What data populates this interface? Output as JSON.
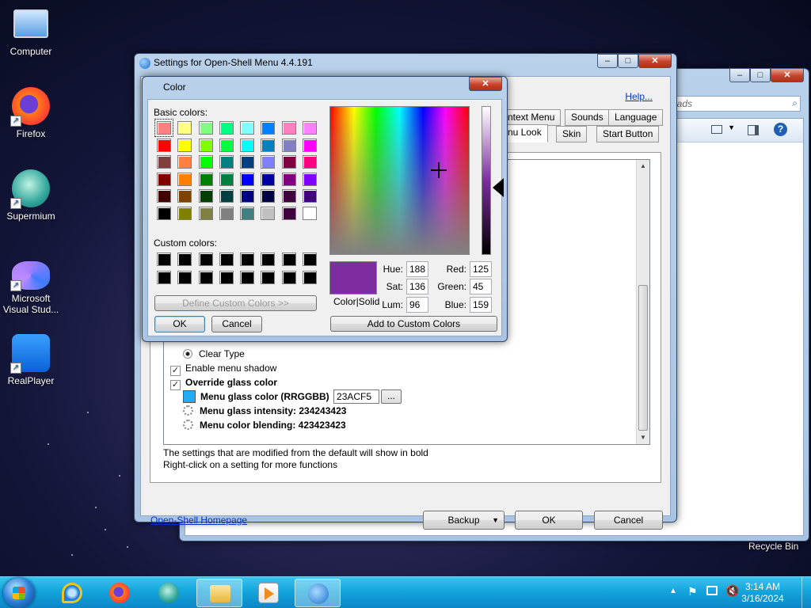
{
  "desktop": {
    "icons": [
      {
        "label": "Computer"
      },
      {
        "label": "Firefox"
      },
      {
        "label": "Supermium"
      },
      {
        "label": "Microsoft\nVisual Stud..."
      },
      {
        "label": "RealPlayer"
      }
    ],
    "recycle_bin": "Recycle Bin"
  },
  "explorer": {
    "search_placeholder": "oads"
  },
  "settings": {
    "title": "Settings for Open-Shell Menu 4.4.191",
    "help": "Help...",
    "tabs": [
      "ntext Menu",
      "Sounds",
      "Language",
      "nu Look",
      "Skin",
      "Start Button"
    ],
    "options": {
      "clear_type": "Clear Type",
      "enable_shadow": "Enable menu shadow",
      "override_glass": "Override glass color",
      "glass_color_label": "Menu glass color (RRGGBB)",
      "glass_color_value": "23ACF5",
      "glass_color_btn": "...",
      "glass_intensity": "Menu glass intensity: 234243423",
      "color_blending": "Menu color blending: 423423423"
    },
    "notes": [
      "The settings that are modified from the default will show in bold",
      "Right-click on a setting for more functions"
    ],
    "homepage": "Open-Shell Homepage",
    "buttons": {
      "backup": "Backup",
      "ok": "OK",
      "cancel": "Cancel"
    }
  },
  "color_dialog": {
    "title": "Color",
    "basic_colors_label": "Basic colors:",
    "custom_colors_label": "Custom colors:",
    "basic_colors": [
      "#ff8080",
      "#ffff80",
      "#80ff80",
      "#00ff80",
      "#80ffff",
      "#0080ff",
      "#ff80c0",
      "#ff80ff",
      "#ff0000",
      "#ffff00",
      "#80ff00",
      "#00ff40",
      "#00ffff",
      "#0080c0",
      "#8080c0",
      "#ff00ff",
      "#804040",
      "#ff8040",
      "#00ff00",
      "#008080",
      "#004080",
      "#8080ff",
      "#800040",
      "#ff0080",
      "#800000",
      "#ff8000",
      "#008000",
      "#008040",
      "#0000ff",
      "#0000a0",
      "#800080",
      "#8000ff",
      "#400000",
      "#804000",
      "#004000",
      "#004040",
      "#000080",
      "#000040",
      "#400040",
      "#400080",
      "#000000",
      "#808000",
      "#808040",
      "#808080",
      "#408080",
      "#c0c0c0",
      "#400040",
      "#ffffff"
    ],
    "custom_colors": [
      "#000000",
      "#000000",
      "#000000",
      "#000000",
      "#000000",
      "#000000",
      "#000000",
      "#000000",
      "#000000",
      "#000000",
      "#000000",
      "#000000",
      "#000000",
      "#000000",
      "#000000",
      "#000000"
    ],
    "define_custom": "Define Custom Colors >>",
    "ok": "OK",
    "cancel": "Cancel",
    "color_solid": "Color|Solid",
    "fields": {
      "hue_label": "Hue:",
      "hue": "188",
      "sat_label": "Sat:",
      "sat": "136",
      "lum_label": "Lum:",
      "lum": "96",
      "red_label": "Red:",
      "red": "125",
      "green_label": "Green:",
      "green": "45",
      "blue_label": "Blue:",
      "blue": "159"
    },
    "add_custom": "Add to Custom Colors",
    "selected_color": "#7d2d9f"
  },
  "taskbar": {
    "time": "3:14 AM",
    "date": "3/16/2024"
  }
}
